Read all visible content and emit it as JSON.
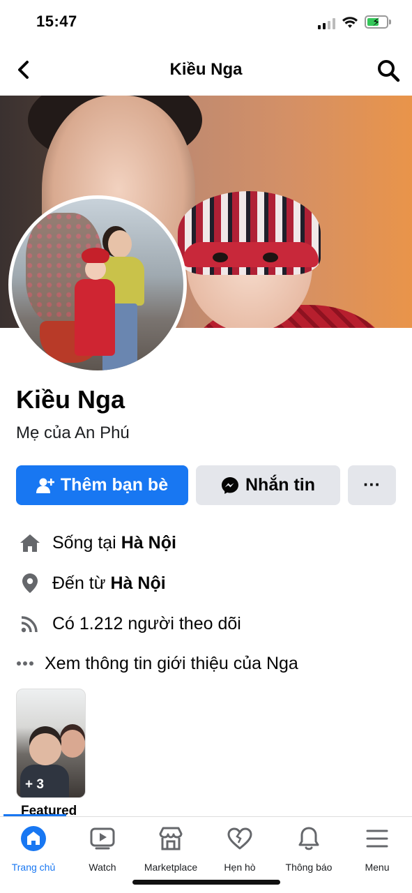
{
  "status_bar": {
    "time": "15:47"
  },
  "header": {
    "title": "Kiều Nga",
    "back_icon": "chevron-left-icon",
    "search_icon": "search-icon"
  },
  "profile": {
    "name": "Kiều Nga",
    "bio": "Mẹ của An Phú"
  },
  "actions": {
    "add_friend": "Thêm bạn bè",
    "message": "Nhắn tin",
    "more": "···"
  },
  "info": {
    "lives_prefix": "Sống tại",
    "lives_city": "Hà Nội",
    "from_prefix": "Đến từ",
    "from_city": "Hà Nội",
    "followers": "Có 1.212 người theo dõi",
    "see_about": "Xem thông tin giới thiệu của Nga"
  },
  "featured": {
    "count": "+ 3",
    "label": "Featured"
  },
  "tabs": [
    {
      "label": "Trang chủ",
      "icon": "home-icon",
      "active": true
    },
    {
      "label": "Watch",
      "icon": "watch-icon",
      "active": false
    },
    {
      "label": "Marketplace",
      "icon": "marketplace-icon",
      "active": false
    },
    {
      "label": "Hẹn hò",
      "icon": "dating-heart-icon",
      "active": false
    },
    {
      "label": "Thông báo",
      "icon": "bell-icon",
      "active": false
    },
    {
      "label": "Menu",
      "icon": "menu-icon",
      "active": false
    }
  ],
  "colors": {
    "accent": "#1877f2",
    "secondary_button": "#e4e6eb"
  }
}
